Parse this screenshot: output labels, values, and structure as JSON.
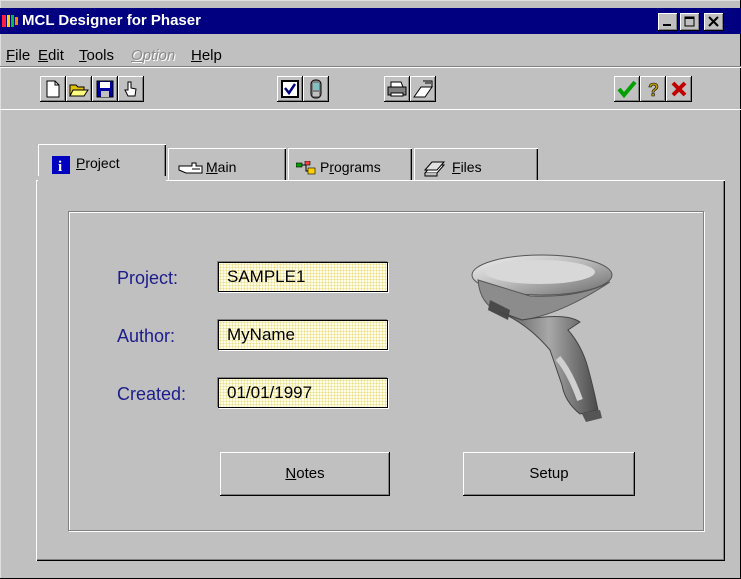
{
  "window": {
    "title": "MCL Designer for Phaser",
    "caption_buttons": [
      "minimize-icon",
      "maximize-icon",
      "close-icon"
    ]
  },
  "menu": [
    {
      "label_u": "F",
      "label_rest": "ile",
      "enabled": true
    },
    {
      "label_u": "E",
      "label_rest": "dit",
      "enabled": true
    },
    {
      "label_u": "T",
      "label_rest": "ools",
      "enabled": true
    },
    {
      "label_u": "O",
      "label_rest": "ption",
      "enabled": false
    },
    {
      "label_u": "H",
      "label_rest": "elp",
      "enabled": true
    }
  ],
  "toolbar": {
    "buttons": [
      "new-file-icon",
      "open-folder-icon",
      "save-disk-icon",
      "hand-pointer-icon",
      "checkbox-icon",
      "device-icon",
      "printer-icon",
      "print-preview-icon",
      "ok-check-icon",
      "help-question-icon",
      "cancel-x-icon"
    ],
    "ok_color": "#00a000",
    "help_color": "#c0a000",
    "cancel_color": "#c00000"
  },
  "tabs": [
    {
      "label_u": "P",
      "label_rest": "roject",
      "icon": "info-icon",
      "active": true
    },
    {
      "label_u": "M",
      "label_rest": "ain",
      "icon": "pointing-hand-icon",
      "active": false
    },
    {
      "label_pre": "P",
      "label_u": "r",
      "label_rest": "ograms",
      "icon": "programs-icon",
      "active": false
    },
    {
      "label_u": "F",
      "label_rest": "iles",
      "icon": "files-stack-icon",
      "active": false
    }
  ],
  "project_form": {
    "project_label": "Project:",
    "project_value": "SAMPLE1",
    "author_label": "Author:",
    "author_value": "MyName",
    "created_label": "Created:",
    "created_value": "01/01/1997"
  },
  "buttons": {
    "notes_u": "N",
    "notes_rest": "otes",
    "setup_label": "Setup"
  },
  "colors": {
    "titlebar": "#000080",
    "label_text": "#1c1c8c",
    "field_bg": "#fffde6",
    "face": "#c0c0c0"
  }
}
